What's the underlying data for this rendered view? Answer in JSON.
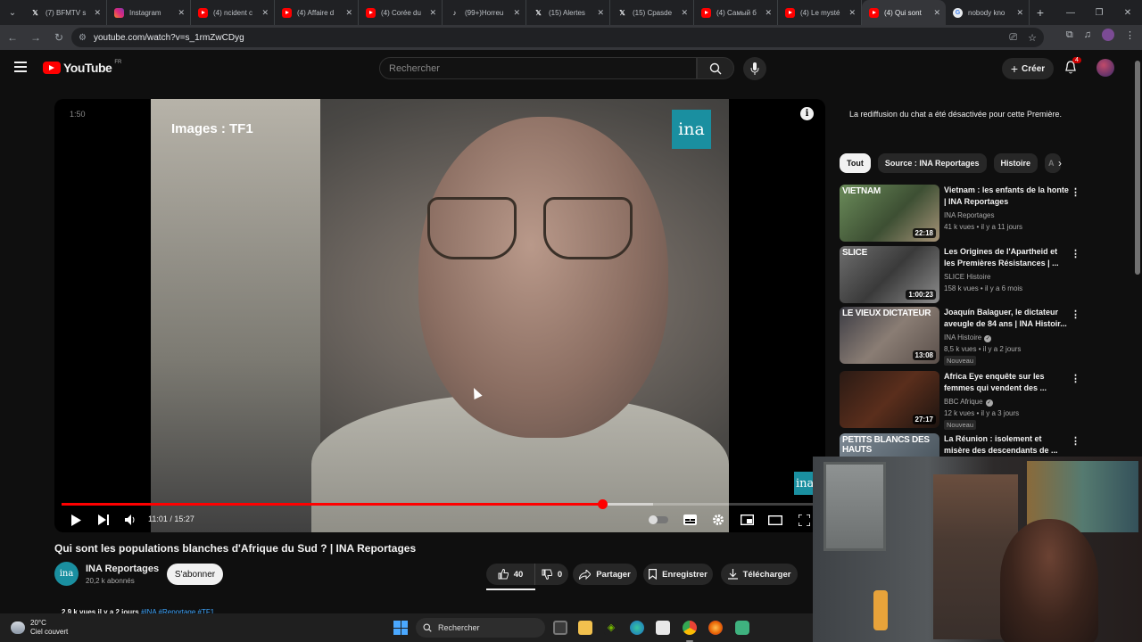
{
  "browser": {
    "tabs": [
      {
        "icon": "x-icon",
        "title": "(7) BFMTV s",
        "active": false
      },
      {
        "icon": "instagram-icon",
        "title": "Instagram",
        "active": false
      },
      {
        "icon": "youtube-icon",
        "title": "(4) ncident c",
        "active": false
      },
      {
        "icon": "youtube-icon",
        "title": "(4) Affaire d",
        "active": false
      },
      {
        "icon": "youtube-icon",
        "title": "(4) Corée du",
        "active": false
      },
      {
        "icon": "tiktok-icon",
        "title": "(99+)Horreu",
        "active": false
      },
      {
        "icon": "x-icon",
        "title": "(15) Alertes",
        "active": false
      },
      {
        "icon": "x-icon",
        "title": "(15) Cpasde",
        "active": false
      },
      {
        "icon": "youtube-icon",
        "title": "(4) Самый б",
        "active": false
      },
      {
        "icon": "youtube-icon",
        "title": "(4) Le mysté",
        "active": false
      },
      {
        "icon": "youtube-icon",
        "title": "(4) Qui sont",
        "active": true
      },
      {
        "icon": "google-icon",
        "title": "nobody kno",
        "active": false
      }
    ],
    "url": "youtube.com/watch?v=s_1rmZwCDyg"
  },
  "header": {
    "logo": "YouTube",
    "country": "FR",
    "search_placeholder": "Rechercher",
    "create_label": "Créer",
    "notifications": "4"
  },
  "player": {
    "overlay_text": "Images : TF1",
    "channel_logo": "ina",
    "corner_timestamp": "1:50",
    "current_time": "11:01",
    "duration": "15:27",
    "time_display": "11:01 / 15:27",
    "progress": 0.713,
    "buffered": 0.78
  },
  "video": {
    "title": "Qui sont les populations blanches d'Afrique du Sud ? | INA Reportages",
    "channel": "INA Reportages",
    "channel_avatar": "ina",
    "subscribers": "20,2 k abonnés",
    "subscribe_label": "S'abonner",
    "likes": "40",
    "dislikes": "0",
    "share_label": "Partager",
    "save_label": "Enregistrer",
    "download_label": "Télécharger",
    "views_date": "2,9 k vues  il y a 2 jours",
    "hashtags": "#INA #Reportage #TF1"
  },
  "sidebar": {
    "chat_notice": "La rediffusion du chat a été désactivée pour cette Première.",
    "chips": [
      "Tout",
      "Source : INA Reportages",
      "Histoire",
      "A"
    ],
    "recommendations": [
      {
        "title": "Vietnam : les enfants de la honte | INA Reportages",
        "channel": "INA Reportages",
        "verified": false,
        "meta": "41 k vues • il y a 11 jours",
        "duration": "22:18",
        "thumb_caption": "VIETNAM",
        "badge": ""
      },
      {
        "title": "Les Origines de l'Apartheid et les Premières Résistances | ...",
        "channel": "SLICE Histoire",
        "verified": false,
        "meta": "158 k vues • il y a 6 mois",
        "duration": "1:00:23",
        "thumb_caption": "SLICE",
        "badge": ""
      },
      {
        "title": "Joaquín Balaguer, le dictateur aveugle de 84 ans | INA Histoir...",
        "channel": "INA Histoire",
        "verified": true,
        "meta": "8,5 k vues • il y a 2 jours",
        "duration": "13:08",
        "thumb_caption": "LE VIEUX DICTATEUR",
        "badge": "Nouveau"
      },
      {
        "title": "Africa Eye enquête sur les femmes qui vendent des ...",
        "channel": "BBC Afrique",
        "verified": true,
        "meta": "12 k vues • il y a 3 jours",
        "duration": "27:17",
        "thumb_caption": "",
        "badge": "Nouveau"
      },
      {
        "title": "La Réunion : isolement et misère des descendants de ...",
        "channel": "",
        "verified": false,
        "meta": "",
        "duration": "",
        "thumb_caption": "PETITS BLANCS DES HAUTS",
        "badge": ""
      }
    ]
  },
  "taskbar": {
    "temperature": "20°C",
    "condition": "Ciel couvert",
    "search_label": "Rechercher"
  },
  "colors": {
    "accent": "#ff0000",
    "ina": "#1a8fa0",
    "background": "#0f0f0f"
  }
}
